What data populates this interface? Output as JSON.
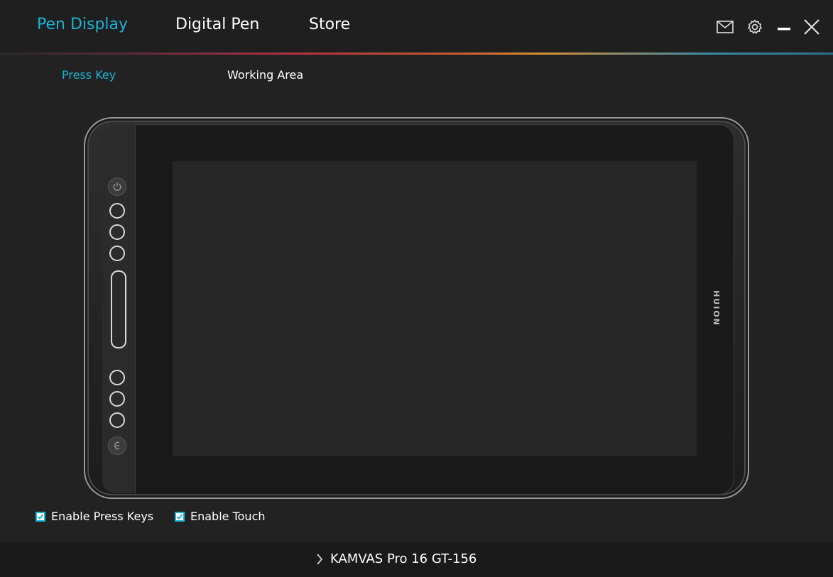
{
  "header": {
    "tabs": [
      {
        "label": "Pen Display",
        "active": true
      },
      {
        "label": "Digital Pen",
        "active": false
      },
      {
        "label": "Store",
        "active": false
      }
    ],
    "icons": [
      "mail-icon",
      "gear-icon",
      "minimize-icon",
      "close-icon"
    ]
  },
  "subtabs": [
    {
      "label": "Press Key",
      "active": true
    },
    {
      "label": "Working Area",
      "active": false
    }
  ],
  "device": {
    "brand": "HUION",
    "express_keys": [
      "power-key",
      "key-1",
      "key-2",
      "key-3",
      "touch-bar",
      "key-4",
      "key-5",
      "key-6",
      "switch-key"
    ]
  },
  "options": {
    "enable_press_keys": {
      "label": "Enable Press Keys",
      "checked": true
    },
    "enable_touch": {
      "label": "Enable Touch",
      "checked": true
    }
  },
  "footer": {
    "device_name": "KAMVAS Pro 16 GT-156"
  },
  "colors": {
    "accent": "#1ab3d4",
    "background": "#222222",
    "footer": "#1a1a1a"
  }
}
